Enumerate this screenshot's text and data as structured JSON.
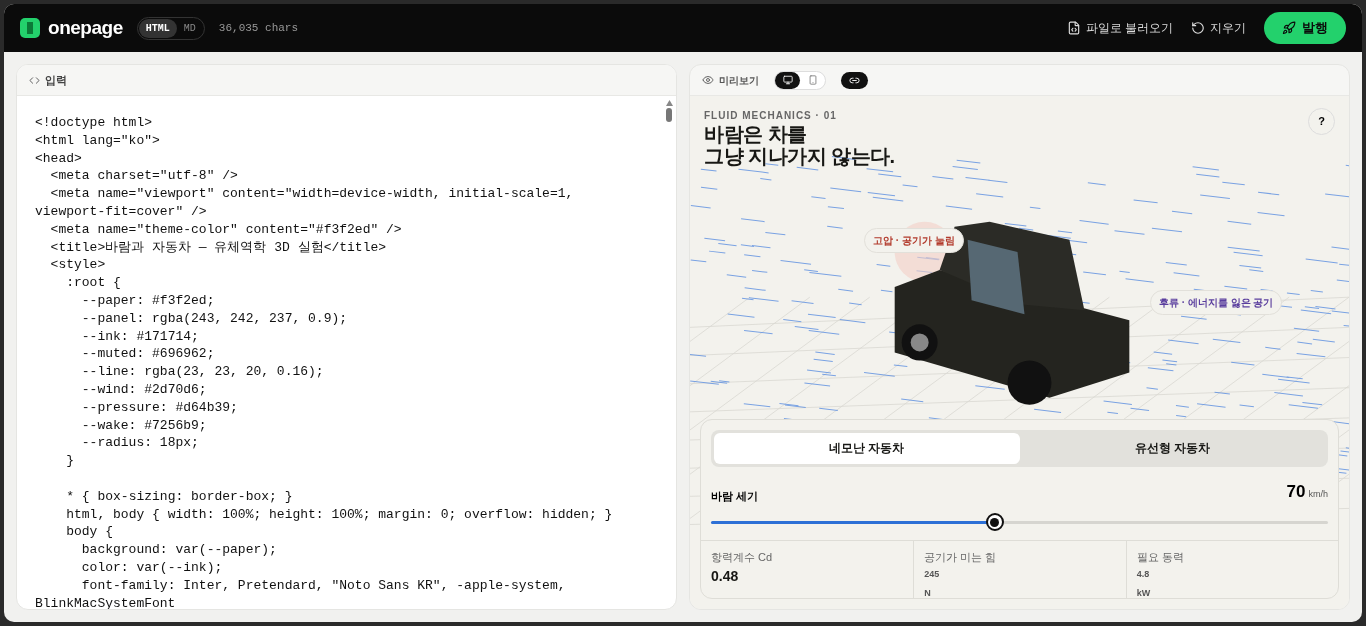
{
  "header": {
    "logo_text": "onepage",
    "formats": [
      {
        "label": "HTML",
        "selected": true
      },
      {
        "label": "MD",
        "selected": false
      }
    ],
    "char_count": "36,035 chars",
    "actions": [
      {
        "kind": "load",
        "label": "파일로 불러오기"
      },
      {
        "kind": "clear",
        "label": "지우기"
      }
    ],
    "publish": "발행"
  },
  "editor": {
    "title": "입력",
    "blocks": [
      [
        "<!doctype html>",
        "<html lang=\"ko\">",
        "<head>",
        "  <meta charset=\"utf-8\" />",
        "  <meta name=\"viewport\" content=\"width=device-width, initial-scale=1, viewport-fit=cover\" />",
        "  <meta name=\"theme-color\" content=\"#f3f2ed\" />",
        "  <title>바람과 자동차 — 유체역학 3D 실험</title>",
        "  <style>",
        "    :root {",
        "      --paper: #f3f2ed;",
        "      --panel: rgba(243, 242, 237, 0.9);",
        "      --ink: #171714;",
        "      --muted: #696962;",
        "      --line: rgba(23, 23, 20, 0.16);",
        "      --wind: #2d70d6;",
        "      --pressure: #d64b39;",
        "      --wake: #7256b9;",
        "      --radius: 18px;",
        "    }"
      ],
      [
        "    * { box-sizing: border-box; }",
        "    html, body { width: 100%; height: 100%; margin: 0; overflow: hidden; }",
        "    body {",
        "      background: var(--paper);",
        "      color: var(--ink);",
        "      font-family: Inter, Pretendard, \"Noto Sans KR\", -apple-system, BlinkMacSystemFont"
      ]
    ]
  },
  "preview": {
    "title": "미리보기",
    "devices": [
      {
        "kind": "desktop",
        "selected": true
      },
      {
        "kind": "mobile",
        "selected": false
      }
    ],
    "page": {
      "eyebrow": "FLUID MECHANICS · 01",
      "headline": [
        "바람은 차를",
        "그냥 지나가지 않는다."
      ],
      "help": "?",
      "labels": [
        {
          "text": "고압 · 공기가 눌림",
          "color": "#b23a2c"
        },
        {
          "text": "후류 · 에너지를 잃은 공기",
          "color": "#5b3f9e"
        }
      ],
      "car_tabs": [
        {
          "label": "네모난 자동차",
          "selected": true
        },
        {
          "label": "유선형 자동차",
          "selected": false
        }
      ],
      "wind": {
        "label": "바람 세기",
        "value": "70",
        "unit": "km/h",
        "level": 0.46
      },
      "stats": [
        {
          "label": "항력계수 Cd",
          "value": "0.48"
        },
        {
          "label": "공기가 미는 힘",
          "value": "245",
          "unit": "N"
        },
        {
          "label": "필요 동력",
          "value": "4.8",
          "unit": "kW"
        }
      ]
    }
  }
}
